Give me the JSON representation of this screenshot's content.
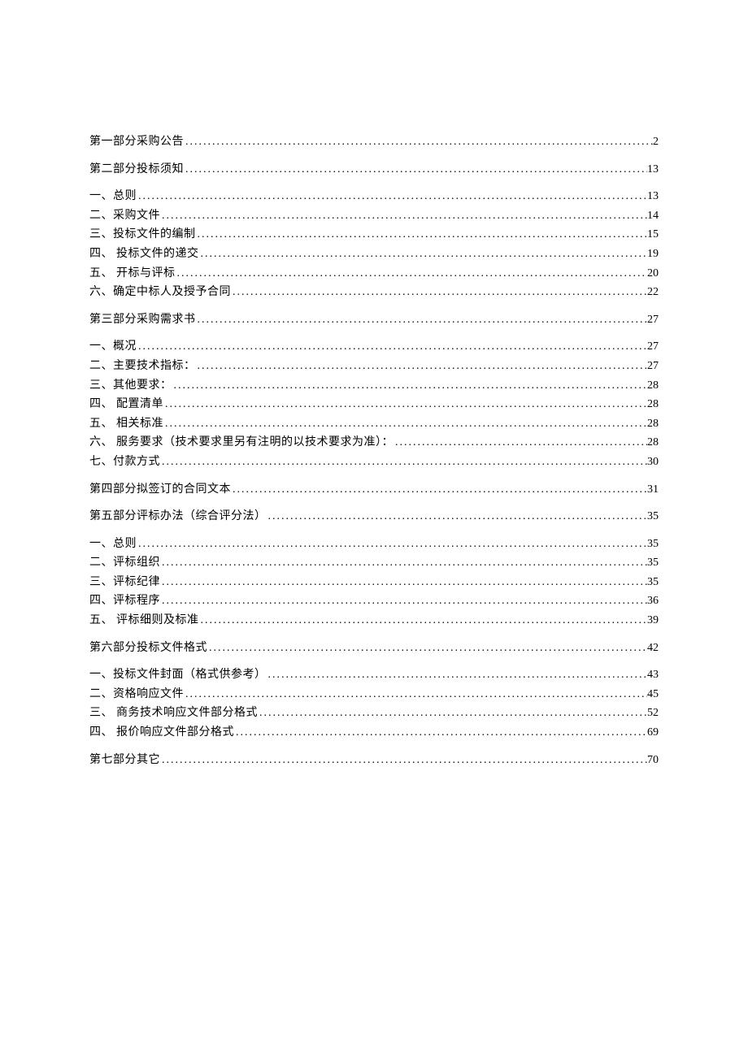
{
  "toc": [
    {
      "type": "section",
      "title": "第一部分采购公告",
      "page": "2"
    },
    {
      "type": "section",
      "title": "第二部分投标须知",
      "page": "13"
    },
    {
      "type": "sub",
      "title": "一、总则",
      "page": "13"
    },
    {
      "type": "sub",
      "title": "二、采购文件",
      "page": "14"
    },
    {
      "type": "sub",
      "title": "三、投标文件的编制",
      "page": "15"
    },
    {
      "type": "sub",
      "title": "四、 投标文件的递交",
      "page": "19"
    },
    {
      "type": "sub",
      "title": "五、 开标与评标",
      "page": "20"
    },
    {
      "type": "sub",
      "title": "六、确定中标人及授予合同",
      "page": "22"
    },
    {
      "type": "section",
      "title": "第三部分采购需求书",
      "page": "27"
    },
    {
      "type": "sub",
      "title": "一、概况",
      "page": "27"
    },
    {
      "type": "sub",
      "title": "二、主要技术指标：",
      "page": "27"
    },
    {
      "type": "sub",
      "title": "三、其他要求：",
      "page": "28"
    },
    {
      "type": "sub",
      "title": "四、 配置清单",
      "page": "28"
    },
    {
      "type": "sub",
      "title": "五、 相关标准",
      "page": "28"
    },
    {
      "type": "sub",
      "title": "六、 服务要求（技术要求里另有注明的以技术要求为准）：",
      "page": "28"
    },
    {
      "type": "sub",
      "title": "七、付款方式",
      "page": "30"
    },
    {
      "type": "section",
      "title": "第四部分拟签订的合同文本",
      "page": "31"
    },
    {
      "type": "section",
      "title": "第五部分评标办法（综合评分法）",
      "page": "35"
    },
    {
      "type": "sub",
      "title": "一、总则",
      "page": "35"
    },
    {
      "type": "sub",
      "title": "二、评标组织",
      "page": "35"
    },
    {
      "type": "sub",
      "title": "三、评标纪律",
      "page": "35"
    },
    {
      "type": "sub",
      "title": "四、评标程序",
      "page": "36"
    },
    {
      "type": "sub",
      "title": "五、 评标细则及标准",
      "page": "39"
    },
    {
      "type": "section",
      "title": "第六部分投标文件格式",
      "page": "42"
    },
    {
      "type": "sub",
      "title": "一、投标文件封面（格式供参考）",
      "page": "43"
    },
    {
      "type": "sub",
      "title": "二、资格响应文件",
      "page": "45"
    },
    {
      "type": "sub",
      "title": "三、 商务技术响应文件部分格式",
      "page": "52"
    },
    {
      "type": "sub",
      "title": "四、 报价响应文件部分格式",
      "page": "69"
    },
    {
      "type": "section",
      "title": "第七部分其它",
      "page": "70"
    }
  ]
}
